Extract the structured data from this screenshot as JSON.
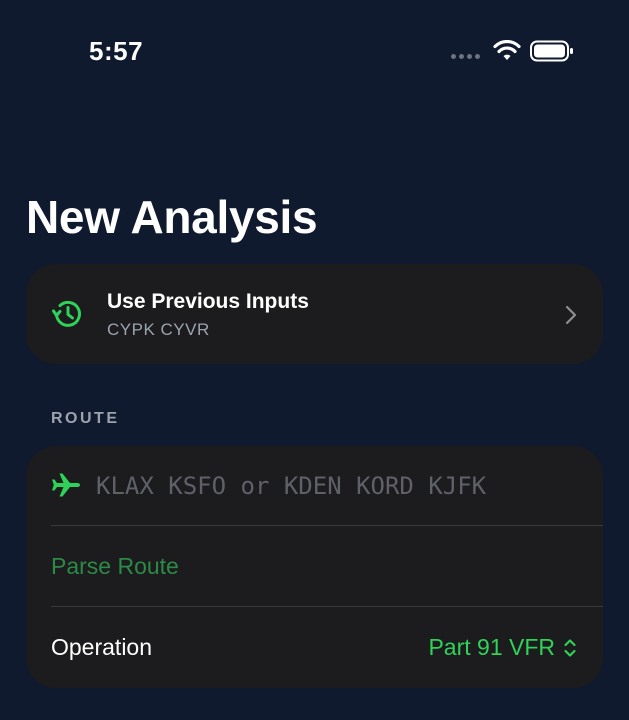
{
  "status_bar": {
    "time": "5:57",
    "icons": [
      "signal-dots-icon",
      "wifi-icon",
      "battery-icon"
    ]
  },
  "page": {
    "title": "New Analysis"
  },
  "previous_inputs": {
    "title": "Use Previous Inputs",
    "subtitle": "CYPK CYVR",
    "icon": "history-icon"
  },
  "route_section": {
    "label": "ROUTE",
    "input_placeholder": "KLAX KSFO or KDEN KORD KJFK",
    "input_value": "",
    "input_icon": "airplane-icon",
    "parse_button": "Parse Route",
    "operation_label": "Operation",
    "operation_value": "Part 91 VFR"
  },
  "colors": {
    "background": "#101a2e",
    "card": "#1c1c1e",
    "accent_green": "#30d158",
    "muted_green": "#2c8a47",
    "secondary_text": "#9ca3af"
  }
}
